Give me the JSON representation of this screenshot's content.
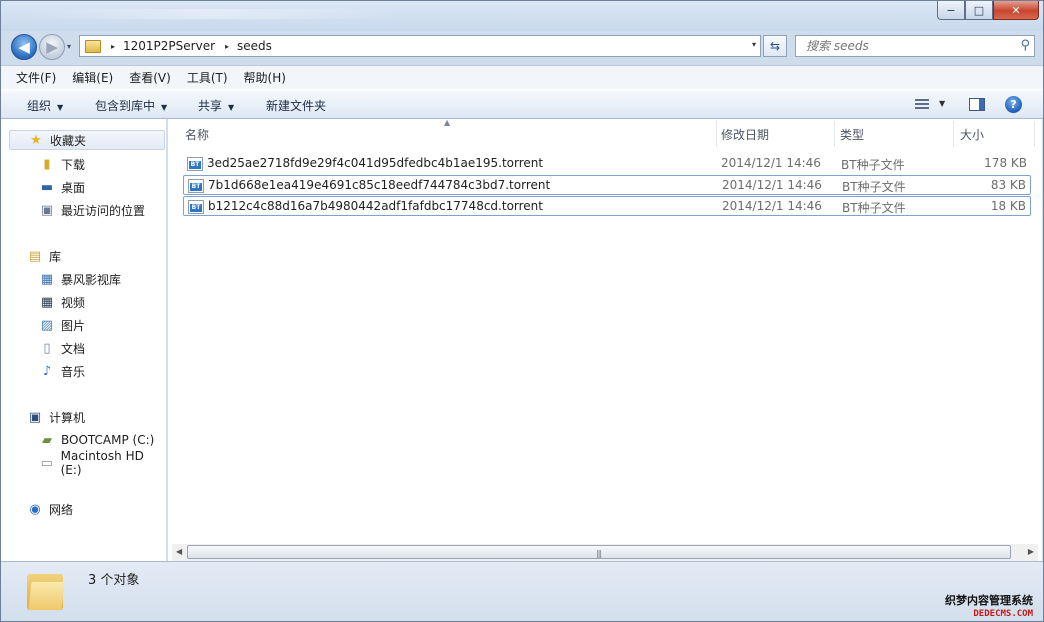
{
  "window": {
    "minimize": "−",
    "maximize": "□",
    "close": "✕"
  },
  "nav": {
    "back": "◀",
    "forward": "▶",
    "dropdown": "▾"
  },
  "address": {
    "crumbs": [
      "1201P2PServer",
      "seeds"
    ],
    "separator": "▸",
    "dropdown": "▾"
  },
  "search": {
    "placeholder": "搜索 seeds"
  },
  "menu": [
    "文件(F)",
    "编辑(E)",
    "查看(V)",
    "工具(T)",
    "帮助(H)"
  ],
  "toolbar": {
    "organize": "组织",
    "include_in_library": "包含到库中",
    "share": "共享",
    "new_folder": "新建文件夹"
  },
  "sidebar": {
    "favorites": {
      "title": "收藏夹",
      "items": [
        "下载",
        "桌面",
        "最近访问的位置"
      ]
    },
    "libraries": {
      "title": "库",
      "items": [
        "暴风影视库",
        "视频",
        "图片",
        "文档",
        "音乐"
      ]
    },
    "computer": {
      "title": "计算机",
      "items": [
        "BOOTCAMP (C:)",
        "Macintosh HD (E:)"
      ]
    },
    "network": {
      "title": "网络"
    }
  },
  "columns": {
    "name": "名称",
    "modified": "修改日期",
    "type": "类型",
    "size": "大小"
  },
  "files": [
    {
      "name": "3ed25ae2718fd9e29f4c041d95dfedbc4b1ae195.torrent",
      "modified": "2014/12/1 14:46",
      "type": "BT种子文件",
      "size": "178 KB"
    },
    {
      "name": "7b1d668e1ea419e4691c85c18eedf744784c3bd7.torrent",
      "modified": "2014/12/1 14:46",
      "type": "BT种子文件",
      "size": "83 KB"
    },
    {
      "name": "b1212c4c88d16a7b4980442adf1fafdbc17748cd.torrent",
      "modified": "2014/12/1 14:46",
      "type": "BT种子文件",
      "size": "18 KB"
    }
  ],
  "file_icon_text": "BT",
  "status": {
    "count": "3 个对象"
  },
  "watermark": {
    "line1": "织梦内容管理系统",
    "line2": "DEDECMS.COM"
  },
  "colors": {
    "accent": "#2d78c6",
    "frame": "#cfdcec"
  }
}
